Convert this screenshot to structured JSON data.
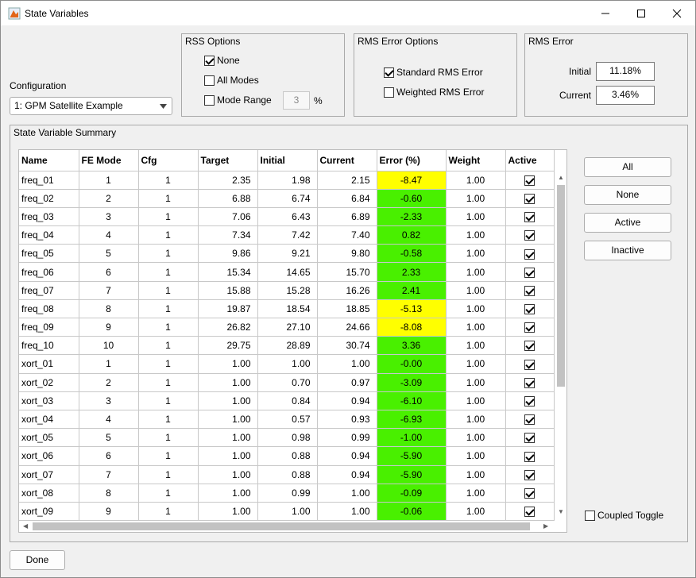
{
  "window": {
    "title": "State Variables"
  },
  "configuration": {
    "label": "Configuration",
    "selected": "1: GPM Satellite Example"
  },
  "rss_options": {
    "title": "RSS Options",
    "none": {
      "label": "None",
      "checked": true
    },
    "all_modes": {
      "label": "All Modes",
      "checked": false
    },
    "mode_range": {
      "label": "Mode Range",
      "checked": false,
      "value": "3",
      "unit": "%"
    }
  },
  "rms_error_options": {
    "title": "RMS Error Options",
    "standard": {
      "label": "Standard RMS Error",
      "checked": true
    },
    "weighted": {
      "label": "Weighted RMS Error",
      "checked": false
    }
  },
  "rms_error": {
    "title": "RMS Error",
    "initial_label": "Initial",
    "initial_value": "11.18%",
    "current_label": "Current",
    "current_value": "3.46%"
  },
  "summary": {
    "title": "State Variable Summary"
  },
  "table": {
    "columns": [
      "Name",
      "FE Mode",
      "Cfg",
      "Target",
      "Initial",
      "Current",
      "Error (%)",
      "Weight",
      "Active"
    ],
    "rows": [
      {
        "name": "freq_01",
        "mode": "1",
        "cfg": "1",
        "target": "2.35",
        "initial": "1.98",
        "current": "2.15",
        "error": "-8.47",
        "weight": "1.00",
        "active": true,
        "color": "#ffff00"
      },
      {
        "name": "freq_02",
        "mode": "2",
        "cfg": "1",
        "target": "6.88",
        "initial": "6.74",
        "current": "6.84",
        "error": "-0.60",
        "weight": "1.00",
        "active": true,
        "color": "#49f000"
      },
      {
        "name": "freq_03",
        "mode": "3",
        "cfg": "1",
        "target": "7.06",
        "initial": "6.43",
        "current": "6.89",
        "error": "-2.33",
        "weight": "1.00",
        "active": true,
        "color": "#49f000"
      },
      {
        "name": "freq_04",
        "mode": "4",
        "cfg": "1",
        "target": "7.34",
        "initial": "7.42",
        "current": "7.40",
        "error": "0.82",
        "weight": "1.00",
        "active": true,
        "color": "#49f000"
      },
      {
        "name": "freq_05",
        "mode": "5",
        "cfg": "1",
        "target": "9.86",
        "initial": "9.21",
        "current": "9.80",
        "error": "-0.58",
        "weight": "1.00",
        "active": true,
        "color": "#49f000"
      },
      {
        "name": "freq_06",
        "mode": "6",
        "cfg": "1",
        "target": "15.34",
        "initial": "14.65",
        "current": "15.70",
        "error": "2.33",
        "weight": "1.00",
        "active": true,
        "color": "#49f000"
      },
      {
        "name": "freq_07",
        "mode": "7",
        "cfg": "1",
        "target": "15.88",
        "initial": "15.28",
        "current": "16.26",
        "error": "2.41",
        "weight": "1.00",
        "active": true,
        "color": "#49f000"
      },
      {
        "name": "freq_08",
        "mode": "8",
        "cfg": "1",
        "target": "19.87",
        "initial": "18.54",
        "current": "18.85",
        "error": "-5.13",
        "weight": "1.00",
        "active": true,
        "color": "#ffff00"
      },
      {
        "name": "freq_09",
        "mode": "9",
        "cfg": "1",
        "target": "26.82",
        "initial": "27.10",
        "current": "24.66",
        "error": "-8.08",
        "weight": "1.00",
        "active": true,
        "color": "#ffff00"
      },
      {
        "name": "freq_10",
        "mode": "10",
        "cfg": "1",
        "target": "29.75",
        "initial": "28.89",
        "current": "30.74",
        "error": "3.36",
        "weight": "1.00",
        "active": true,
        "color": "#49f000"
      },
      {
        "name": "xort_01",
        "mode": "1",
        "cfg": "1",
        "target": "1.00",
        "initial": "1.00",
        "current": "1.00",
        "error": "-0.00",
        "weight": "1.00",
        "active": true,
        "color": "#49f000"
      },
      {
        "name": "xort_02",
        "mode": "2",
        "cfg": "1",
        "target": "1.00",
        "initial": "0.70",
        "current": "0.97",
        "error": "-3.09",
        "weight": "1.00",
        "active": true,
        "color": "#49f000"
      },
      {
        "name": "xort_03",
        "mode": "3",
        "cfg": "1",
        "target": "1.00",
        "initial": "0.84",
        "current": "0.94",
        "error": "-6.10",
        "weight": "1.00",
        "active": true,
        "color": "#49f000"
      },
      {
        "name": "xort_04",
        "mode": "4",
        "cfg": "1",
        "target": "1.00",
        "initial": "0.57",
        "current": "0.93",
        "error": "-6.93",
        "weight": "1.00",
        "active": true,
        "color": "#49f000"
      },
      {
        "name": "xort_05",
        "mode": "5",
        "cfg": "1",
        "target": "1.00",
        "initial": "0.98",
        "current": "0.99",
        "error": "-1.00",
        "weight": "1.00",
        "active": true,
        "color": "#49f000"
      },
      {
        "name": "xort_06",
        "mode": "6",
        "cfg": "1",
        "target": "1.00",
        "initial": "0.88",
        "current": "0.94",
        "error": "-5.90",
        "weight": "1.00",
        "active": true,
        "color": "#49f000"
      },
      {
        "name": "xort_07",
        "mode": "7",
        "cfg": "1",
        "target": "1.00",
        "initial": "0.88",
        "current": "0.94",
        "error": "-5.90",
        "weight": "1.00",
        "active": true,
        "color": "#49f000"
      },
      {
        "name": "xort_08",
        "mode": "8",
        "cfg": "1",
        "target": "1.00",
        "initial": "0.99",
        "current": "1.00",
        "error": "-0.09",
        "weight": "1.00",
        "active": true,
        "color": "#49f000"
      },
      {
        "name": "xort_09",
        "mode": "9",
        "cfg": "1",
        "target": "1.00",
        "initial": "1.00",
        "current": "1.00",
        "error": "-0.06",
        "weight": "1.00",
        "active": true,
        "color": "#49f000"
      }
    ]
  },
  "buttons": {
    "all": "All",
    "none": "None",
    "active": "Active",
    "inactive": "Inactive",
    "done": "Done"
  },
  "coupled_toggle": {
    "label": "Coupled Toggle",
    "checked": false
  }
}
